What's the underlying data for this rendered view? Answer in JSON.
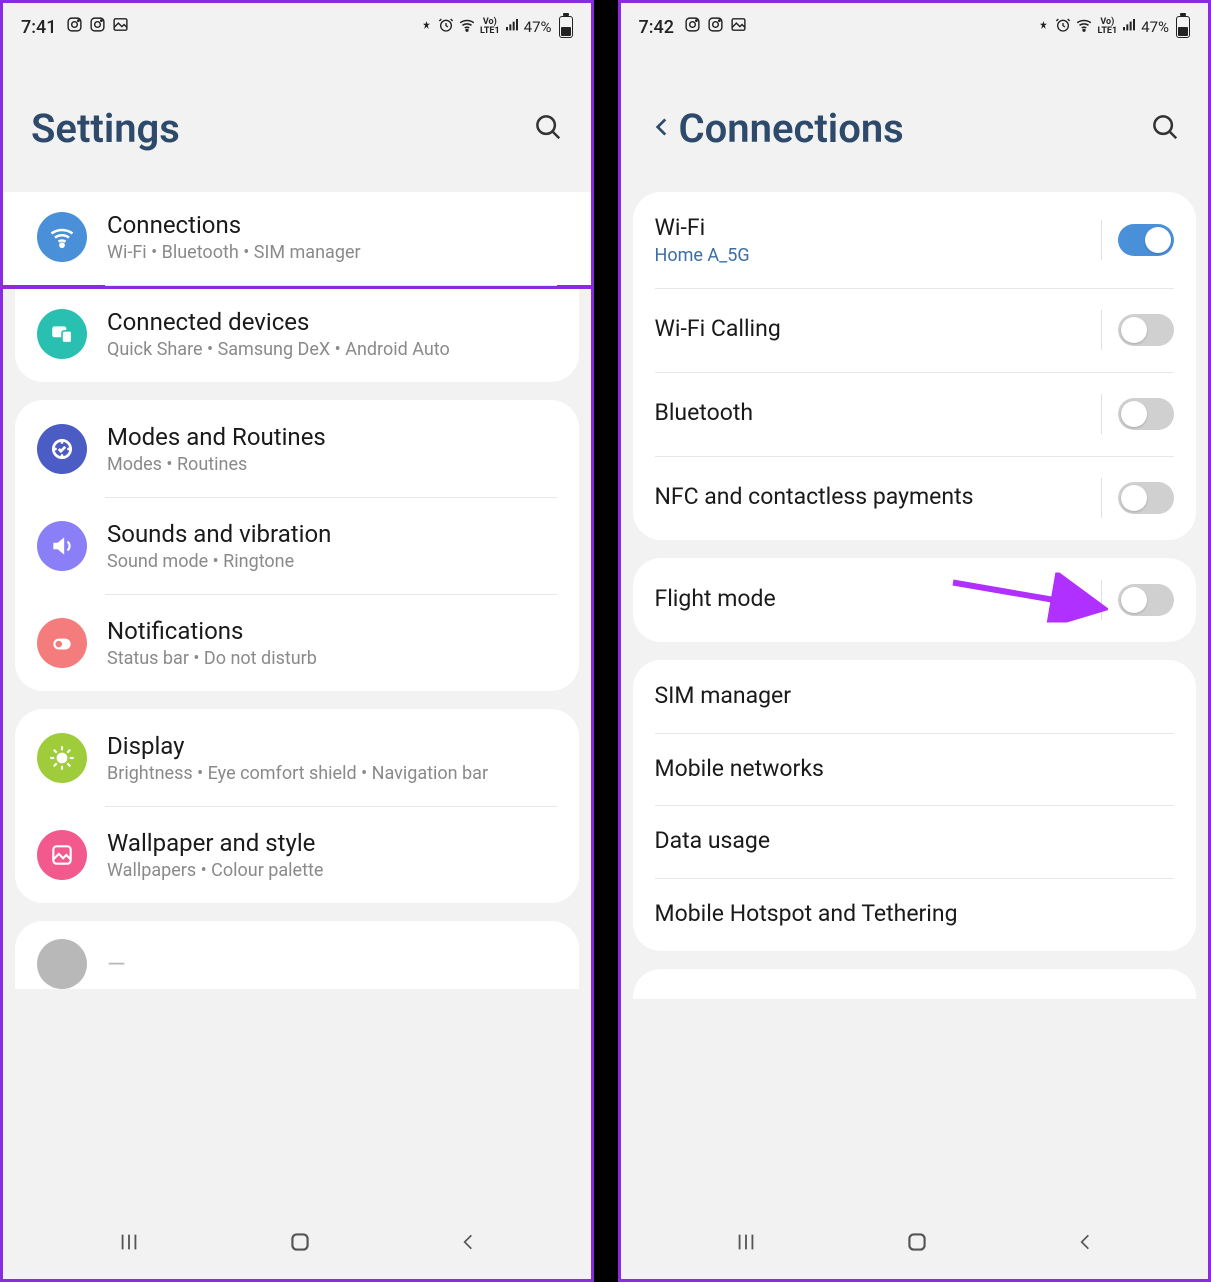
{
  "left": {
    "status": {
      "time": "7:41",
      "battery": "47%"
    },
    "header": "Settings",
    "items": [
      {
        "title": "Connections",
        "sub": "Wi-Fi  •  Bluetooth  •  SIM manager"
      },
      {
        "title": "Connected devices",
        "sub": "Quick Share  •  Samsung DeX  •  Android Auto"
      },
      {
        "title": "Modes and Routines",
        "sub": "Modes  •  Routines"
      },
      {
        "title": "Sounds and vibration",
        "sub": "Sound mode  •  Ringtone"
      },
      {
        "title": "Notifications",
        "sub": "Status bar  •  Do not disturb"
      },
      {
        "title": "Display",
        "sub": "Brightness  •  Eye comfort shield  •  Navigation bar"
      },
      {
        "title": "Wallpaper and style",
        "sub": "Wallpapers  •  Colour palette"
      }
    ]
  },
  "right": {
    "status": {
      "time": "7:42",
      "battery": "47%"
    },
    "header": "Connections",
    "group1": [
      {
        "title": "Wi-Fi",
        "sub": "Home A_5G",
        "toggle": true
      },
      {
        "title": "Wi-Fi Calling",
        "toggle": false
      },
      {
        "title": "Bluetooth",
        "toggle": false
      },
      {
        "title": "NFC and contactless payments",
        "toggle": false
      }
    ],
    "group2": [
      {
        "title": "Flight mode",
        "toggle": false
      }
    ],
    "group3": [
      {
        "title": "SIM manager"
      },
      {
        "title": "Mobile networks"
      },
      {
        "title": "Data usage"
      },
      {
        "title": "Mobile Hotspot and Tethering"
      }
    ]
  }
}
